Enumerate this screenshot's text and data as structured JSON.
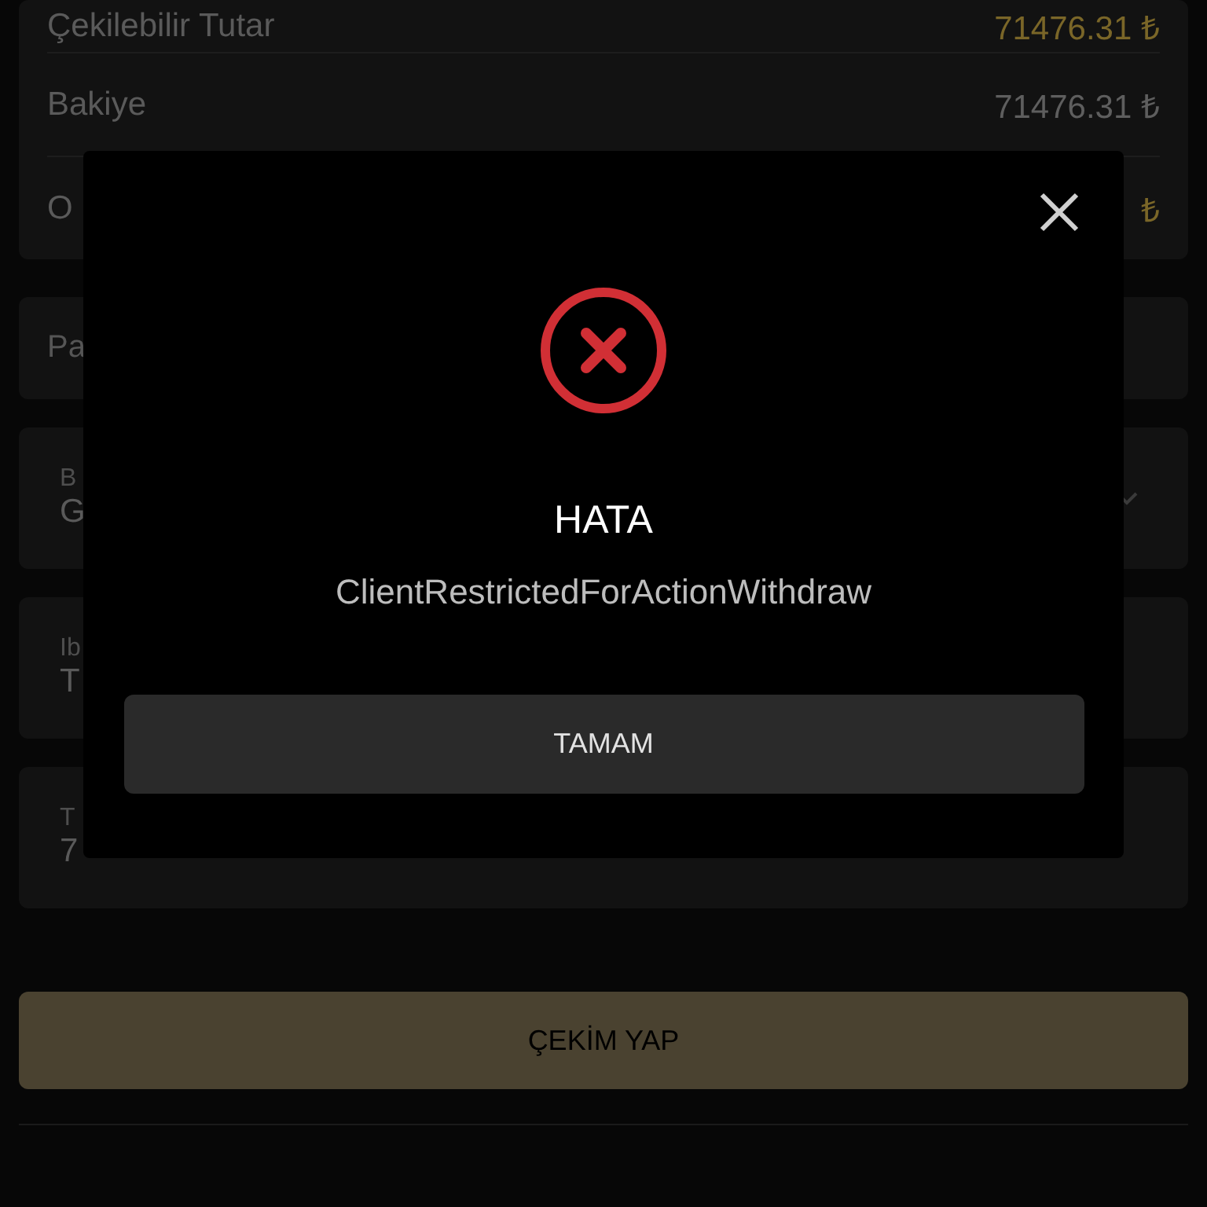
{
  "balance": {
    "rows": [
      {
        "label": "Çekilebilir Tutar",
        "value": "71476.31 ₺"
      },
      {
        "label": "Bakiye",
        "value": "71476.31 ₺"
      },
      {
        "label": "O",
        "value": "₺"
      }
    ]
  },
  "notice": {
    "text": "Pa"
  },
  "fields": [
    {
      "kind": "select",
      "label": "B",
      "value": "G"
    },
    {
      "kind": "text",
      "label": "Ib",
      "value": "T"
    },
    {
      "kind": "text",
      "label": "T",
      "value": "7"
    }
  ],
  "submit_button": "ÇEKİM YAP",
  "dialog": {
    "title": "HATA",
    "message": "ClientRestrictedForActionWithdraw",
    "button": "TAMAM"
  }
}
